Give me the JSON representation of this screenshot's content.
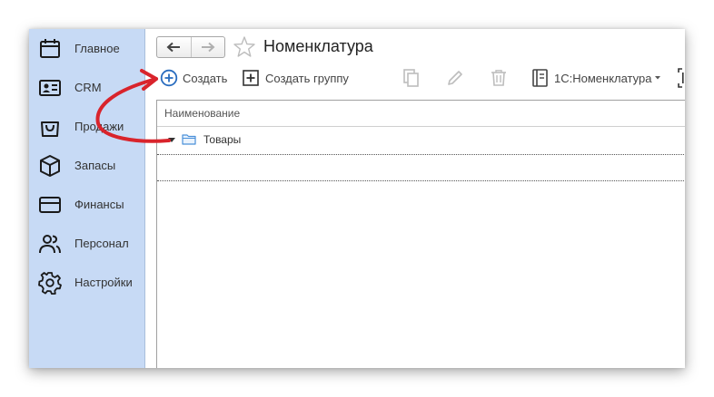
{
  "sidebar": {
    "items": [
      {
        "label": "Главное",
        "icon": "calendar-icon"
      },
      {
        "label": "CRM",
        "icon": "contact-card-icon"
      },
      {
        "label": "Продажи",
        "icon": "shopping-bag-icon"
      },
      {
        "label": "Запасы",
        "icon": "box-icon"
      },
      {
        "label": "Финансы",
        "icon": "credit-card-icon"
      },
      {
        "label": "Персонал",
        "icon": "people-icon"
      },
      {
        "label": "Настройки",
        "icon": "gear-icon"
      }
    ]
  },
  "header": {
    "title": "Номенклатура"
  },
  "toolbar": {
    "create_label": "Создать",
    "create_group_label": "Создать группу",
    "catalog_label": "1С:Номенклатура"
  },
  "table": {
    "columns": [
      "Наименование"
    ],
    "rows": [
      {
        "name": "Товары",
        "type": "group",
        "expanded": true
      },
      {
        "name": "",
        "type": "empty"
      }
    ]
  },
  "annotation": {
    "arrow_color": "#d9242c",
    "points_to": "create-button"
  },
  "colors": {
    "sidebar_bg": "#c7daf5",
    "accent": "#2a6dbf",
    "folder": "#4a90d9"
  }
}
